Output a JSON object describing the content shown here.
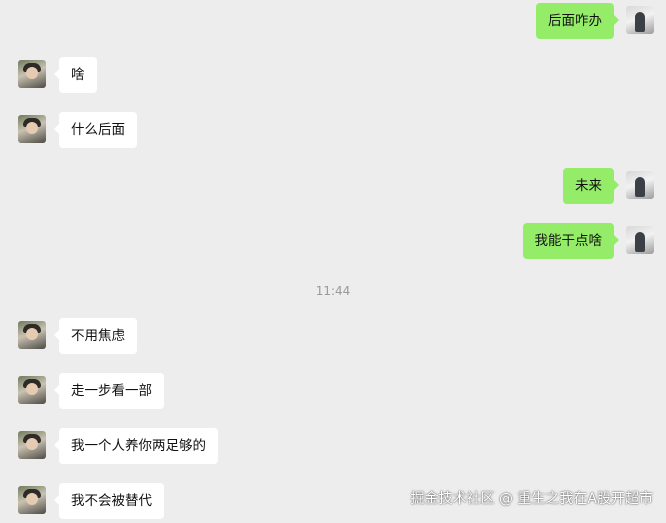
{
  "chat": {
    "messages": [
      {
        "side": "out",
        "text": "后面咋办"
      },
      {
        "side": "in",
        "text": "啥"
      },
      {
        "side": "in",
        "text": "什么后面"
      },
      {
        "side": "out",
        "text": "未来"
      },
      {
        "side": "out",
        "text": "我能干点啥"
      },
      {
        "side": "in",
        "text": "不用焦虑"
      },
      {
        "side": "in",
        "text": "走一步看一部"
      },
      {
        "side": "in",
        "text": "我一个人养你两足够的"
      },
      {
        "side": "in",
        "text": "我不会被替代"
      }
    ],
    "timestamp": "11:44"
  },
  "colors": {
    "background": "#ededed",
    "incoming_bubble": "#ffffff",
    "outgoing_bubble": "#95ec69"
  },
  "watermark": "掘金技术社区 @ 重生之我在A股开超市"
}
